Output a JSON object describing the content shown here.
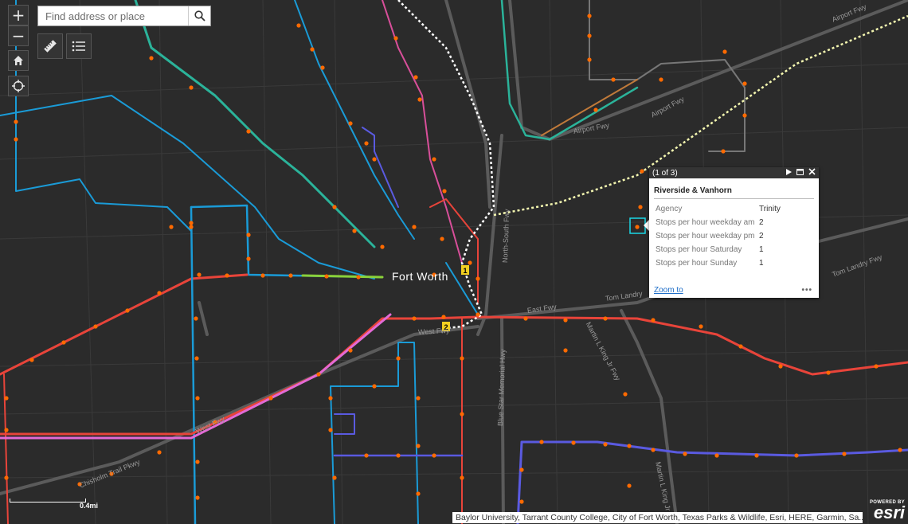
{
  "search": {
    "placeholder": "Find address or place"
  },
  "controls": {
    "zoom_in": "+",
    "zoom_out": "−"
  },
  "map": {
    "city_label": "Fort Worth",
    "road_labels": [
      {
        "text": "Airport Fwy"
      },
      {
        "text": "Airport Fwy"
      },
      {
        "text": "Airport Fwy"
      },
      {
        "text": "North-South Fwy"
      },
      {
        "text": "Tom Landry Fwy"
      },
      {
        "text": "Tom Landry"
      },
      {
        "text": "East Fwy"
      },
      {
        "text": "West Fwy"
      },
      {
        "text": "West Fwy"
      },
      {
        "text": "Martin L King Jr Fwy"
      },
      {
        "text": "Blue Star Memorial Hwy"
      },
      {
        "text": "Chisholm Trail Pkwy"
      },
      {
        "text": "Martin L King Jr"
      }
    ],
    "shields": [
      "1",
      "2"
    ],
    "colors": {
      "background": "#2b2b2b",
      "stop": "#ff6a00",
      "route_red": "#e8443a",
      "route_blue": "#1a9bd7",
      "route_teal": "#2bb39a",
      "route_pink": "#e36ad6",
      "route_violet": "#5a5ae0",
      "rail_white": "#ffffff",
      "rail_yellow": "#f4f7b0"
    }
  },
  "popup": {
    "pager": "(1 of 3)",
    "title": "Riverside & Vanhorn",
    "fields": [
      {
        "key": "Agency",
        "value": "Trinity"
      },
      {
        "key": "Stops per hour weekday am",
        "value": "2"
      },
      {
        "key": "Stops per hour weekday pm",
        "value": "2"
      },
      {
        "key": "Stops per hour Saturday",
        "value": "1"
      },
      {
        "key": "Stops per hour Sunday",
        "value": "1"
      }
    ],
    "zoom_to": "Zoom to",
    "more": "•••"
  },
  "scale": {
    "label": "0.4mi"
  },
  "attribution": "Baylor University, Tarrant County College, City of Fort Worth, Texas Parks & Wildlife, Esri, HERE, Garmin, Sa...",
  "esri": {
    "powered": "POWERED BY",
    "logo": "esri"
  }
}
